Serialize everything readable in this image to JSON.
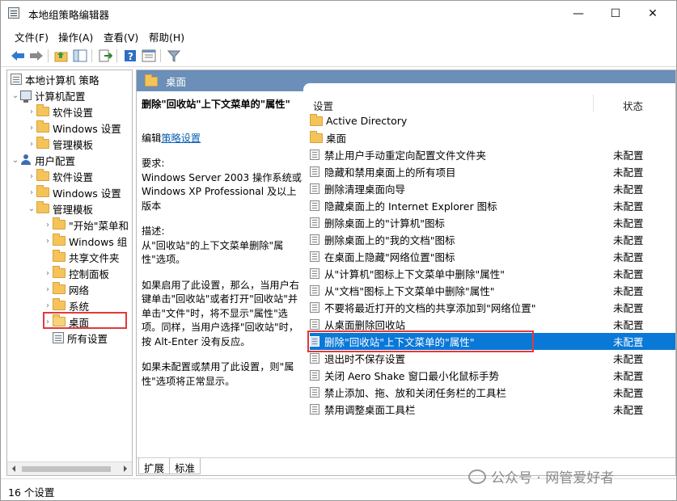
{
  "window": {
    "title": "本地组策略编辑器",
    "controls": {
      "minimize": "—",
      "maximize": "☐",
      "close": "✕"
    }
  },
  "menubar": {
    "items": [
      "文件(F)",
      "操作(A)",
      "查看(V)",
      "帮助(H)"
    ]
  },
  "toolbar": {
    "icons": [
      "back-icon",
      "forward-icon",
      "up-folder-icon",
      "show-hide-tree-icon",
      "export-list-icon",
      "help-icon",
      "properties-icon",
      "filter-icon"
    ]
  },
  "tree": {
    "root": "本地计算机 策略",
    "computer_config": "计算机配置",
    "cc_software": "软件设置",
    "cc_windows": "Windows 设置",
    "cc_admin": "管理模板",
    "user_config": "用户配置",
    "uc_software": "软件设置",
    "uc_windows": "Windows 设置",
    "uc_admin": "管理模板",
    "start_menu": "\"开始\"菜单和",
    "windows_components": "Windows 组",
    "shared_folders": "共享文件夹",
    "control_panel": "控制面板",
    "network": "网络",
    "system": "系统",
    "desktop": "桌面",
    "all_settings": "所有设置"
  },
  "right": {
    "header": "桌面",
    "desc_title": "删除\"回收站\"上下文菜单的\"属性\"",
    "edit_prefix": "编辑",
    "edit_link": "策略设置",
    "req_label": "要求:",
    "req_text": "Windows Server 2003 操作系统或 Windows XP Professional 及以上版本",
    "desc_label": "描述:",
    "desc_text": "从\"回收站\"的上下文菜单删除\"属性\"选项。",
    "enabled_text": "如果启用了此设置，那么，当用户右键单击\"回收站\"或者打开\"回收站\"并单击\"文件\"时，将不显示\"属性\"选项。同样，当用户选择\"回收站\"时，按 Alt-Enter 没有反应。",
    "disabled_text": "如果未配置或禁用了此设置，则\"属性\"选项将正常显示。",
    "col_setting": "设置",
    "col_state": "状态",
    "folders": [
      "Active Directory",
      "桌面"
    ],
    "settings": [
      {
        "name": "禁止用户手动重定向配置文件文件夹",
        "state": "未配置"
      },
      {
        "name": "隐藏和禁用桌面上的所有项目",
        "state": "未配置"
      },
      {
        "name": "删除清理桌面向导",
        "state": "未配置"
      },
      {
        "name": "隐藏桌面上的 Internet Explorer 图标",
        "state": "未配置"
      },
      {
        "name": "删除桌面上的\"计算机\"图标",
        "state": "未配置"
      },
      {
        "name": "删除桌面上的\"我的文档\"图标",
        "state": "未配置"
      },
      {
        "name": "在桌面上隐藏\"网络位置\"图标",
        "state": "未配置"
      },
      {
        "name": "从\"计算机\"图标上下文菜单中删除\"属性\"",
        "state": "未配置"
      },
      {
        "name": "从\"文档\"图标上下文菜单中删除\"属性\"",
        "state": "未配置"
      },
      {
        "name": "不要将最近打开的文档的共享添加到\"网络位置\"",
        "state": "未配置"
      },
      {
        "name": "从桌面删除回收站",
        "state": "未配置"
      },
      {
        "name": "删除\"回收站\"上下文菜单的\"属性\"",
        "state": "未配置"
      },
      {
        "name": "退出时不保存设置",
        "state": "未配置"
      },
      {
        "name": "关闭 Aero Shake 窗口最小化鼠标手势",
        "state": "未配置"
      },
      {
        "name": "禁止添加、拖、放和关闭任务栏的工具栏",
        "state": "未配置"
      },
      {
        "name": "禁用调整桌面工具栏",
        "state": "未配置"
      }
    ],
    "tabs": [
      "扩展",
      "标准"
    ]
  },
  "status": {
    "text": "16 个设置"
  },
  "watermark": {
    "text": "公众号 · 网管爱好者"
  },
  "colors": {
    "selection": "#0a78d7",
    "header": "#6b8fb8",
    "highlight_box": "#e03a3a"
  }
}
